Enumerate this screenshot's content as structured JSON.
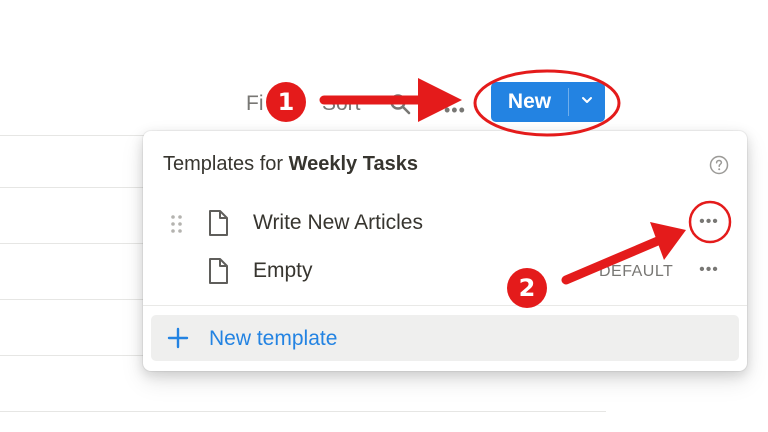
{
  "toolbar": {
    "filter_label": "Fi",
    "sort_label": "Sort",
    "more_label": "•••",
    "new_label": "New"
  },
  "popup": {
    "header_prefix": "Templates for ",
    "database_name": "Weekly Tasks",
    "templates": [
      {
        "label": "Write New Articles",
        "more": "•••"
      },
      {
        "label": "Empty",
        "badge": "DEFAULT",
        "more": "•••"
      }
    ],
    "new_template_label": "New template"
  },
  "annotations": {
    "step_1": "1",
    "step_2": "2"
  },
  "colors": {
    "accent": "#2383e2",
    "annotation_red": "#e41b1b"
  },
  "icons": [
    "search-icon",
    "chevron-down-icon",
    "help-icon",
    "drag-handle-icon",
    "document-icon",
    "more-icon",
    "plus-icon"
  ]
}
